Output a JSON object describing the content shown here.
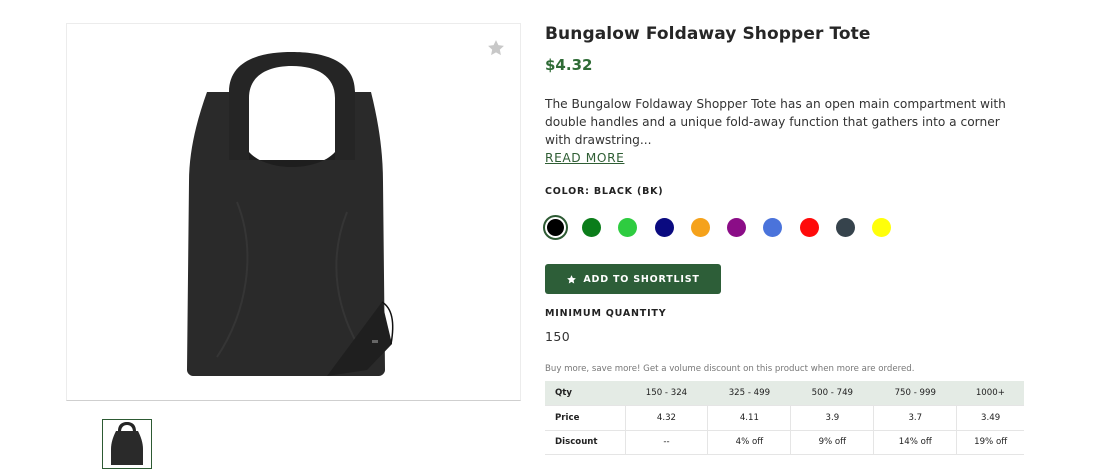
{
  "product": {
    "title": "Bungalow Foldaway Shopper Tote",
    "price": "$4.32",
    "description": "The Bungalow Foldaway Shopper Tote has an open main compartment with double handles and a unique fold-away function that gathers into a corner with drawstring...",
    "read_more": "READ MORE"
  },
  "gallery": {
    "favorite_icon": "star-icon",
    "main_image": "black-tote-bag",
    "thumbnail": "black-tote-bag"
  },
  "color": {
    "label": "COLOR: BLACK (BK)",
    "swatches": [
      {
        "color": "#000000",
        "selected": true
      },
      {
        "color": "#0b7d1a",
        "selected": false
      },
      {
        "color": "#2ecc40",
        "selected": false
      },
      {
        "color": "#0a0a80",
        "selected": false
      },
      {
        "color": "#f5a21b",
        "selected": false
      },
      {
        "color": "#8b0d87",
        "selected": false
      },
      {
        "color": "#4a73db",
        "selected": false
      },
      {
        "color": "#ff0a0a",
        "selected": false
      },
      {
        "color": "#36434c",
        "selected": false
      },
      {
        "color": "#ffff0a",
        "selected": false
      }
    ]
  },
  "shortlist_button": {
    "label": "ADD TO SHORTLIST",
    "icon": "star-icon"
  },
  "minimum_quantity": {
    "label": "MINIMUM QUANTITY",
    "value": "150"
  },
  "volume": {
    "note": "Buy more, save more! Get a volume discount on this product when more are ordered.",
    "header": [
      "Qty",
      "150 - 324",
      "325 - 499",
      "500 - 749",
      "750 - 999",
      "1000+"
    ],
    "rows": [
      [
        "Price",
        "4.32",
        "4.11",
        "3.9",
        "3.7",
        "3.49"
      ],
      [
        "Discount",
        "--",
        "4% off",
        "9% off",
        "14% off",
        "19% off"
      ]
    ]
  },
  "colors": {
    "accent": "#2d5e38",
    "price": "#2f6b36",
    "table_header_bg": "#e4ebe5"
  }
}
